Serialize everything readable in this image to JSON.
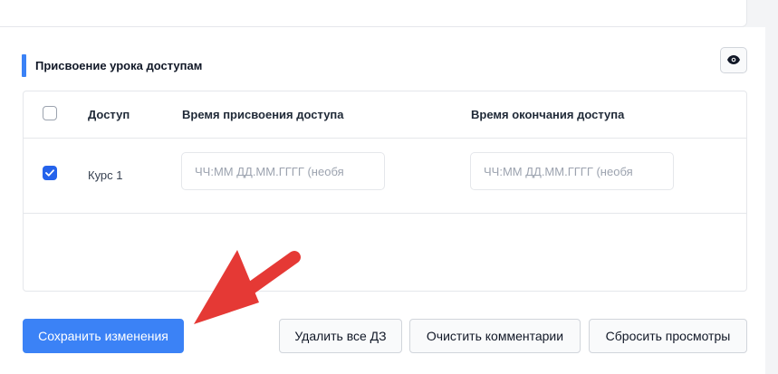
{
  "section": {
    "title": "Присвоение урока доступам",
    "accent_color": "#3b82f6"
  },
  "icons": {
    "preview": "eye-icon",
    "check": "checkmark-icon",
    "annotation": "red-arrow-icon"
  },
  "table": {
    "columns": [
      "Доступ",
      "Время присвоения доступа",
      "Время окончания доступа"
    ],
    "rows": [
      {
        "access": "Курс 1",
        "checked": true,
        "assign_time": "",
        "assign_placeholder": "ЧЧ:ММ ДД.ММ.ГГГГ (необя",
        "end_time": "",
        "end_placeholder": "ЧЧ:ММ ДД.ММ.ГГГГ (необя"
      }
    ],
    "select_all_checked": false
  },
  "actions": {
    "save": "Сохранить изменения",
    "delete_homework": "Удалить все ДЗ",
    "clear_comments": "Очистить комментарии",
    "reset_views": "Сбросить просмотры"
  },
  "colors": {
    "primary": "#3b82f6",
    "checkbox": "#2563eb",
    "arrow": "#e53935"
  }
}
